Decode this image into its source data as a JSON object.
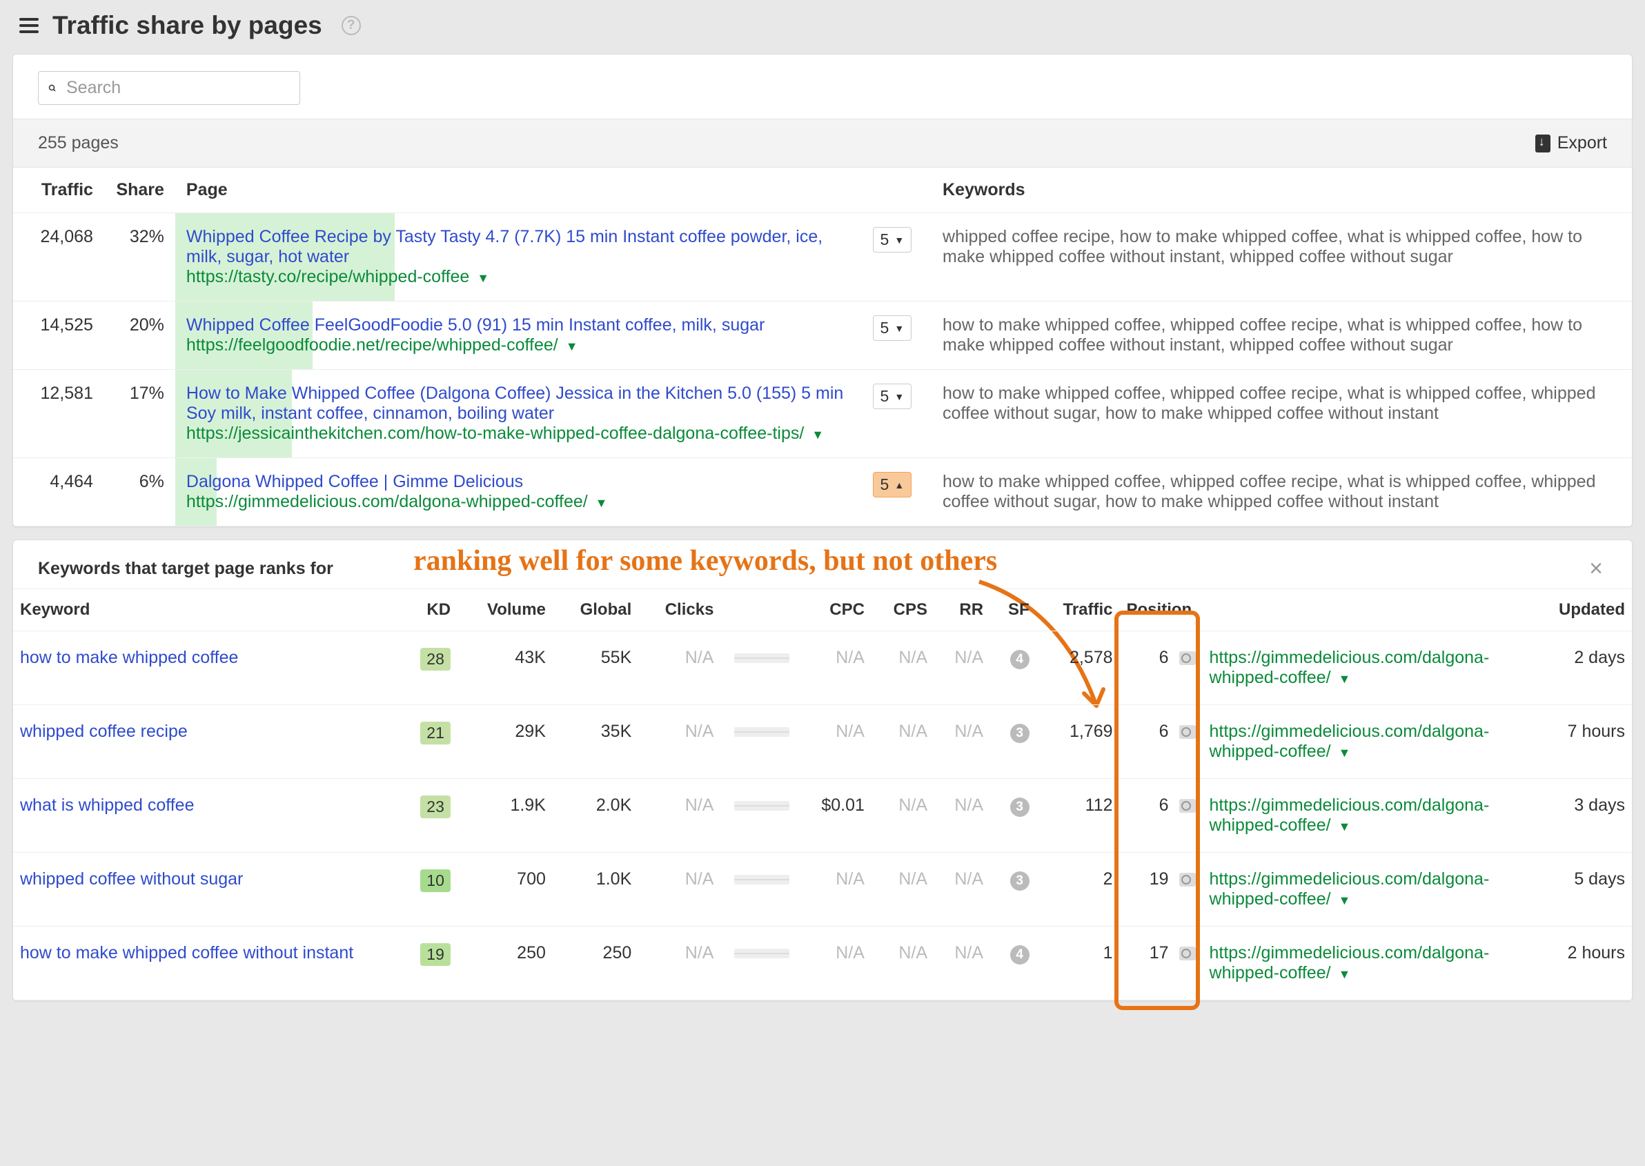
{
  "header": {
    "title": "Traffic share by pages",
    "search_placeholder": "Search",
    "pages_count": "255 pages",
    "export_label": "Export"
  },
  "columns_top": {
    "traffic": "Traffic",
    "share": "Share",
    "page": "Page",
    "keywords": "Keywords"
  },
  "rows_top": [
    {
      "traffic": "24,068",
      "share": "32%",
      "bar_pct": 32,
      "title": "Whipped Coffee Recipe by Tasty Tasty 4.7 (7.7K) 15 min Instant coffee powder, ice, milk, sugar, hot water",
      "url": "https://tasty.co/recipe/whipped-coffee",
      "kw_count": "5",
      "kw_active": false,
      "keywords": "whipped coffee recipe, how to make whipped coffee, what is whipped coffee, how to make whipped coffee without instant, whipped coffee without sugar"
    },
    {
      "traffic": "14,525",
      "share": "20%",
      "bar_pct": 20,
      "title": "Whipped Coffee FeelGoodFoodie 5.0 (91) 15 min Instant coffee, milk, sugar",
      "url": "https://feelgoodfoodie.net/recipe/whipped-coffee/",
      "kw_count": "5",
      "kw_active": false,
      "keywords": "how to make whipped coffee, whipped coffee recipe, what is whipped coffee, how to make whipped coffee without instant, whipped coffee without sugar"
    },
    {
      "traffic": "12,581",
      "share": "17%",
      "bar_pct": 17,
      "title": "How to Make Whipped Coffee (Dalgona Coffee) Jessica in the Kitchen 5.0 (155) 5 min Soy milk, instant coffee, cinnamon, boiling water",
      "url": "https://jessicainthekitchen.com/how-to-make-whipped-coffee-dalgona-coffee-tips/",
      "kw_count": "5",
      "kw_active": false,
      "keywords": "how to make whipped coffee, whipped coffee recipe, what is whipped coffee, whipped coffee without sugar, how to make whipped coffee without instant"
    },
    {
      "traffic": "4,464",
      "share": "6%",
      "bar_pct": 6,
      "title": "Dalgona Whipped Coffee | Gimme Delicious",
      "url": "https://gimmedelicious.com/dalgona-whipped-coffee/",
      "kw_count": "5",
      "kw_active": true,
      "keywords": "how to make whipped coffee, whipped coffee recipe, what is whipped coffee, whipped coffee without sugar, how to make whipped coffee without instant"
    }
  ],
  "detail": {
    "title": "Keywords that target page ranks for",
    "annotation": "ranking well for some keywords, but not others",
    "columns": {
      "keyword": "Keyword",
      "kd": "KD",
      "volume": "Volume",
      "global": "Global",
      "clicks": "Clicks",
      "cpc": "CPC",
      "cps": "CPS",
      "rr": "RR",
      "sf": "SF",
      "traffic": "Traffic",
      "position": "Position",
      "updated": "Updated"
    },
    "rows": [
      {
        "keyword": "how to make whipped coffee",
        "kd": "28",
        "kd_color": "#c5e0a5",
        "volume": "43K",
        "global": "55K",
        "clicks": "N/A",
        "cpc": "N/A",
        "cps": "N/A",
        "rr": "N/A",
        "sf": "4",
        "traffic": "2,578",
        "position": "6",
        "url": "https://gimmedelicious.com/dalgona-whipped-coffee/",
        "updated": "2 days"
      },
      {
        "keyword": "whipped coffee recipe",
        "kd": "21",
        "kd_color": "#c5e0a5",
        "volume": "29K",
        "global": "35K",
        "clicks": "N/A",
        "cpc": "N/A",
        "cps": "N/A",
        "rr": "N/A",
        "sf": "3",
        "traffic": "1,769",
        "position": "6",
        "url": "https://gimmedelicious.com/dalgona-whipped-coffee/",
        "updated": "7 hours"
      },
      {
        "keyword": "what is whipped coffee",
        "kd": "23",
        "kd_color": "#c5e0a5",
        "volume": "1.9K",
        "global": "2.0K",
        "clicks": "N/A",
        "cpc": "$0.01",
        "cps": "N/A",
        "rr": "N/A",
        "sf": "3",
        "traffic": "112",
        "position": "6",
        "url": "https://gimmedelicious.com/dalgona-whipped-coffee/",
        "updated": "3 days"
      },
      {
        "keyword": "whipped coffee without sugar",
        "kd": "10",
        "kd_color": "#a6db8e",
        "volume": "700",
        "global": "1.0K",
        "clicks": "N/A",
        "cpc": "N/A",
        "cps": "N/A",
        "rr": "N/A",
        "sf": "3",
        "traffic": "2",
        "position": "19",
        "url": "https://gimmedelicious.com/dalgona-whipped-coffee/",
        "updated": "5 days"
      },
      {
        "keyword": "how to make whipped coffee without instant",
        "kd": "19",
        "kd_color": "#b8e09a",
        "volume": "250",
        "global": "250",
        "clicks": "N/A",
        "cpc": "N/A",
        "cps": "N/A",
        "rr": "N/A",
        "sf": "4",
        "traffic": "1",
        "position": "17",
        "url": "https://gimmedelicious.com/dalgona-whipped-coffee/",
        "updated": "2 hours"
      }
    ]
  }
}
